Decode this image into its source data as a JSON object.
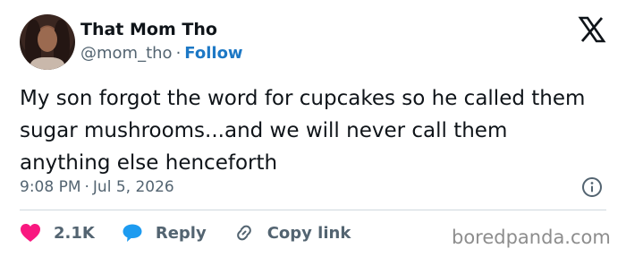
{
  "author": {
    "name": "That Mom Tho",
    "handle": "@mom_tho",
    "separator": "·",
    "follow_label": "Follow"
  },
  "tweet": {
    "text": "My son forgot the word for cupcakes so he called them sugar mushrooms...and we will never call them anything else henceforth",
    "time": "9:08 PM",
    "separator": "·",
    "date": "Jul 5, 2026"
  },
  "actions": {
    "likes_count": "2.1K",
    "reply_label": "Reply",
    "copy_link_label": "Copy link"
  },
  "watermark": "boredpanda.com",
  "icons": {
    "platform": "x-logo-icon",
    "info": "info-icon",
    "like": "heart-icon",
    "reply": "speech-bubble-icon",
    "copy_link": "link-icon"
  },
  "colors": {
    "text": "#0f1419",
    "secondary": "#536471",
    "follow": "#1d78c5",
    "heart": "#f91880",
    "reply_bubble": "#1d9bf0",
    "divider": "#cfd9de"
  }
}
